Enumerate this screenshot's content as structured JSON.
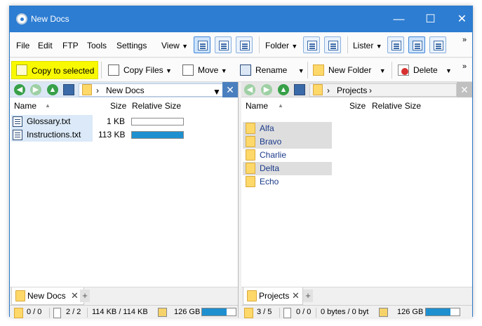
{
  "window": {
    "title": "New Docs",
    "min": "—",
    "max": "☐",
    "close": "✕"
  },
  "menu": {
    "items": [
      "File",
      "Edit",
      "FTP",
      "Tools",
      "Settings",
      "View",
      "Folder",
      "Lister"
    ],
    "more": "»"
  },
  "toolbar": {
    "copy_selected": "Copy to selected",
    "copy_files": "Copy Files",
    "move": "Move",
    "rename": "Rename",
    "new_folder": "New Folder",
    "delete": "Delete",
    "more": "»"
  },
  "left": {
    "path": "New Docs",
    "columns": {
      "name": "Name",
      "size": "Size",
      "relative": "Relative Size"
    },
    "files": [
      {
        "name": "Glossary.txt",
        "size": "1 KB",
        "relative": 0.0
      },
      {
        "name": "Instructions.txt",
        "size": "113 KB",
        "relative": 1.0
      }
    ],
    "tab": "New Docs",
    "status": {
      "folders": "0 / 0",
      "files": "2 / 2",
      "bytes": "114 KB / 114 KB",
      "free": "126 GB",
      "drive_used": 0.72
    }
  },
  "right": {
    "path": "Projects",
    "columns": {
      "name": "Name",
      "size": "Size",
      "relative": "Relative Size"
    },
    "folders": [
      "Alfa",
      "Bravo",
      "Charlie",
      "Delta",
      "Echo"
    ],
    "tab": "Projects",
    "status": {
      "folders": "3 / 5",
      "files": "0 / 0",
      "bytes": "0 bytes / 0 byt",
      "free": "126 GB",
      "drive_used": 0.72
    }
  },
  "colors": {
    "accent": "#2d7dd2",
    "highlight": "#f8f800",
    "folder": "#ffd86a",
    "bar": "#1e90d0"
  }
}
